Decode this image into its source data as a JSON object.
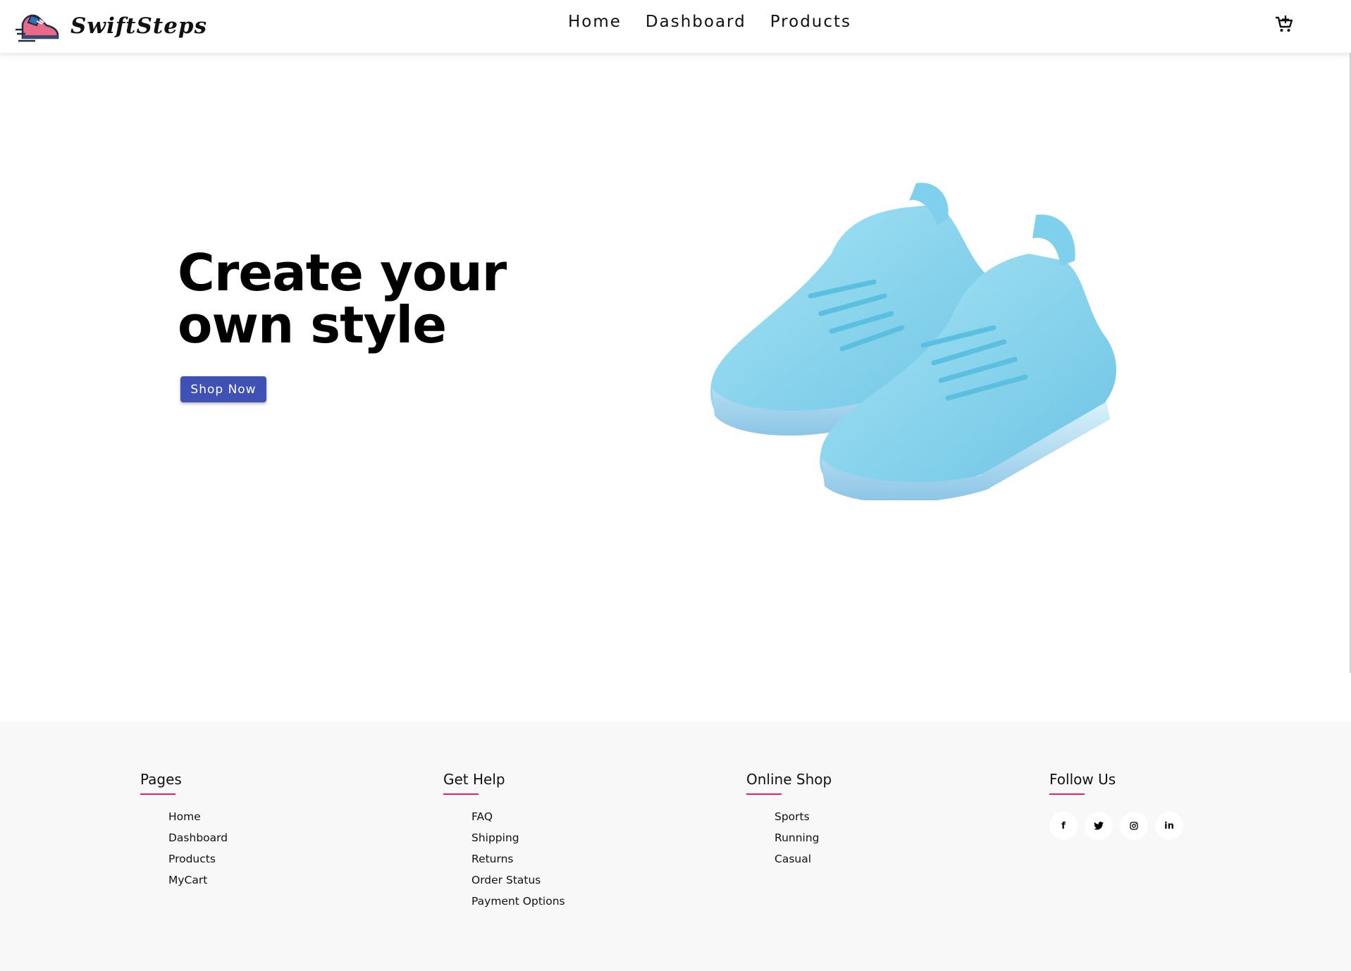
{
  "brand": {
    "name": "SwiftSteps"
  },
  "nav": {
    "items": [
      "Home",
      "Dashboard",
      "Products"
    ]
  },
  "hero": {
    "title_line1": "Create your",
    "title_line2": "own style",
    "cta": "Shop Now"
  },
  "footer": {
    "columns": [
      {
        "heading": "Pages",
        "links": [
          "Home",
          "Dashboard",
          "Products",
          "MyCart"
        ]
      },
      {
        "heading": "Get Help",
        "links": [
          "FAQ",
          "Shipping",
          "Returns",
          "Order Status",
          "Payment Options"
        ]
      },
      {
        "heading": "Online Shop",
        "links": [
          "Sports",
          "Running",
          "Casual"
        ]
      },
      {
        "heading": "Follow Us",
        "social": [
          "facebook",
          "twitter",
          "instagram",
          "linkedin"
        ]
      }
    ]
  },
  "colors": {
    "accent": "#3f51b5",
    "underline": "#e91e63",
    "shoe": "#8fd3ea",
    "footer_bg": "#f8f8f8"
  }
}
